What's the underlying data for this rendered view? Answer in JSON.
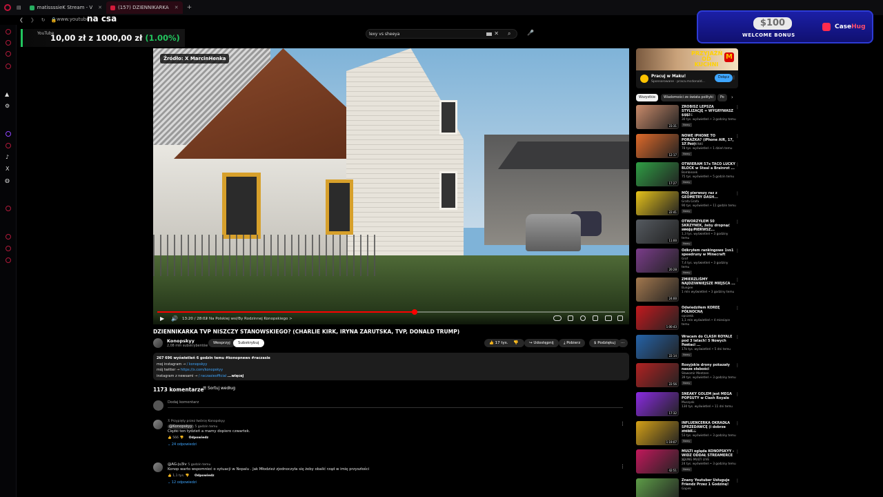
{
  "browser": {
    "tabs": [
      {
        "label": "matissssieK Stream - V",
        "color": "#27ae60"
      },
      {
        "label": "(157) DZIENNIKARKA",
        "color": "#d11b3a"
      }
    ],
    "url": "www.youtube"
  },
  "overlay": {
    "nacsa": "na csa",
    "yt_label": "YouTube",
    "goal_amount": "10,00 zł z 1000,00 zł",
    "goal_pct": "(1.00%)"
  },
  "search": {
    "query": "lexy vs sheeya",
    "clear_icon": "close-icon",
    "search_icon": "search-icon",
    "mic_icon": "mic-icon"
  },
  "casehug_ad": {
    "amount": "$100",
    "subtitle": "WELCOME BONUS",
    "brand_a": "Case",
    "brand_b": "Hug"
  },
  "player": {
    "source_badge": "Źródło: X MarcinHenka",
    "time": "13:20 / 28:02",
    "chapter": "• Na Polskiej wsi/By Rodzinnej Konopskiego >",
    "progress_pct": 55
  },
  "video": {
    "title": "DZIENNIKARKA TVP NISZCZY STANOWSKIEGO? (CHARLIE KIRK, IRYNA ZARUTSKA, TVP, DONALD TRUMP)",
    "channel": "Konopskyy",
    "subs": "2,08 mln subskrybentów",
    "support": "Wesprzyj",
    "subscribe": "Subskrybuj",
    "likes": "17 tys.",
    "share": "Udostępnij",
    "download": "Pobierz",
    "thanks": "Podziękuj",
    "desc_line1": "267 696 wyświetleń  6 godzin temu  #konopnews #raczasie",
    "desc_line2": "moj instagram → ",
    "desc_line2b": "/ konopskyy",
    "desc_line3": "mój twitter → ",
    "desc_line3b": "https://x.com/konopskyy",
    "desc_line4": "instagram z newsami → ",
    "desc_line4b": "/ raczasieofficial",
    "desc_more": "...więcej"
  },
  "comments": {
    "count": "1173 komentarze",
    "sort": "Sortuj według",
    "add": "Dodaj komentarz",
    "items": [
      {
        "pinned": "Przypięty przez twórcę Konopskyy",
        "author": "@Konopskyy",
        "time": "5 godzin temu",
        "text": "Ciężki ten tydzień a mamy dopiero czwartek.",
        "likes": "566",
        "reply": "Odpowiedz",
        "replies": "24 odpowiedzi"
      },
      {
        "author": "@AG-ju3lv",
        "time": "5 godzin temu",
        "text": "Konop warto wspomnieć o sytuacji w Nepalu . Jak Młodzież zjednoczyła się żeby obalić rząd w imię przyszłości",
        "likes": "1,1 tys.",
        "reply": "Odpowiedz",
        "replies": "12 odpowiedzi"
      }
    ]
  },
  "sidebar_ad": {
    "promo": "PRZYJAŹŃ OD KUCHNI",
    "logo": "M",
    "title": "Pracuj w Maku!",
    "sub": "Sponsorowane · praca.mcdonald...",
    "button": "Dołącz"
  },
  "chips": [
    "Wszystkie",
    "Wiadomości ze świata polityki",
    "Po"
  ],
  "recommendations": [
    {
      "title": "ZROBISZ LEPSZĄ STYLIZACJĘ = WYGRYWASZ $$$!",
      "channel": "GENZIE",
      "meta": "30 tys. wyświetleń • 3 godziny temu",
      "dur": "23:31",
      "badge": "Nowy",
      "thumb": "#c98a6a"
    },
    {
      "title": "NOWE IPHONE TO PORAŻKA? (iPhone AIR, 17, 17 Pro)",
      "channel": "TECHNOWINKI",
      "meta": "78 tys. wyświetleń • 1 dzień temu",
      "dur": "12:17",
      "badge": "Nowy",
      "thumb": "#e06a2a"
    },
    {
      "title": "OTWIERAM 57x TACO LUCKY BLOCK w Steal a Brainrot ...",
      "channel": "Bombissek",
      "meta": "75 tys. wyświetleń • 5 godzin temu",
      "dur": "17:27",
      "badge": "Nowy",
      "thumb": "#2f9e44"
    },
    {
      "title": "MÓJ pierwszy raz z GEOMETRY DASH...",
      "channel": "Grafa Grafa",
      "meta": "90 tys. wyświetleń • 11 godzin temu",
      "dur": "22:41",
      "badge": "Nowy",
      "thumb": "#e6c21a"
    },
    {
      "title": "OTWORZYŁEM 50 SKRZYNEK, żeby dropnąć swoją PIERWSZ...",
      "channel": "MROCEK cs2",
      "meta": "1,3 tys. wyświetleń • 3 godziny temu",
      "dur": "11:00",
      "badge": "Nowy",
      "thumb": "#555a60"
    },
    {
      "title": "Odkryłem rankingowe 1vs1 speedruny w Minecraft",
      "channel": "Grof",
      "meta": "7,4 tys. wyświetleń • 3 godziny temu",
      "dur": "20:28",
      "badge": "Nowy",
      "thumb": "#7a3c8a"
    },
    {
      "title": "ZMIERZLIŚMY NAJDZIWNIEJSZE MIEJSCA ...",
      "channel": "Bungee",
      "meta": "1 mln wyświetleń • 3 godziny temu",
      "dur": "24:00",
      "badge": "",
      "thumb": "#a3784e"
    },
    {
      "title": "Odwiedziłem KOREĘ PÓŁNOCNĄ",
      "channel": "opszekk",
      "meta": "1,1 mln wyświetleń • 4 miesiące temu",
      "dur": "1:00:43",
      "badge": "",
      "thumb": "#c4191e"
    },
    {
      "title": "Wracam do CLASH ROYALE pod 3 latach! 5 Nowych Postaci ...",
      "channel": "Fartill",
      "meta": "17k tys. wyświetleń • 5 dni temu",
      "dur": "22:14",
      "badge": "Nowy",
      "thumb": "#2563a8"
    },
    {
      "title": "Rosyjskie drony pokazały nasze słabości",
      "channel": "Sławomir Mentzen",
      "meta": "39 tys. wyświetleń • 3 godziny temu",
      "dur": "22:56",
      "badge": "Nowy",
      "thumb": "#b22222"
    },
    {
      "title": "SNEAKY GOLEM jest MEGA POPSUTY w Clash Royale",
      "channel": "Muszyek",
      "meta": "130 tys. wyświetleń • 11 dni temu",
      "dur": "17:32",
      "badge": "",
      "thumb": "#8a2be2"
    },
    {
      "title": "INFLUENCERKA OKRADŁA SPRZEDAWCĘ (i dobrze zrobił...",
      "channel": "YOSHI GG",
      "meta": "53 tys. wyświetleń • 3 godziny temu",
      "dur": "1:19:07",
      "badge": "Nowy",
      "thumb": "#d4a017"
    },
    {
      "title": "MULTI ogląda KONOPSKYY - WIDZ ODDAŁ STREAMERCE ...",
      "channel": "YOUNG MULTI LIVE",
      "meta": "24 tys. wyświetleń • 3 godziny temu",
      "dur": "42:51",
      "badge": "Nowy",
      "thumb": "#c2185b"
    },
    {
      "title": "Znany Youtuber Usługuje Friendz Przez 1 Godzinę!",
      "channel": "Gapek",
      "meta": "",
      "dur": "",
      "badge": "",
      "thumb": "#5d9c47"
    }
  ]
}
